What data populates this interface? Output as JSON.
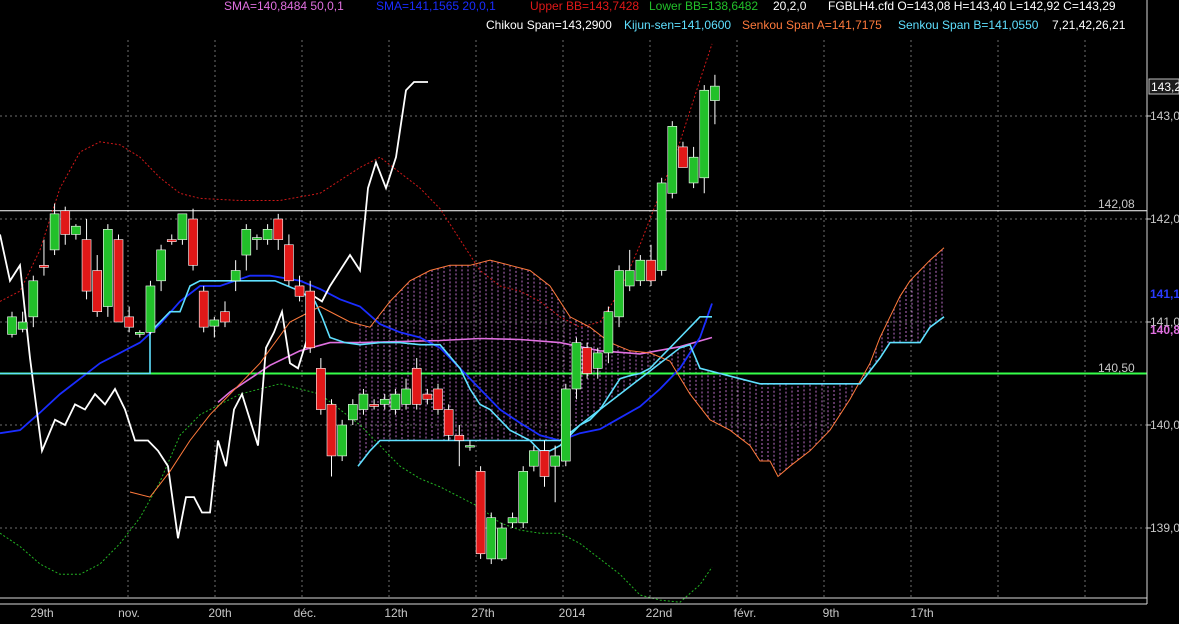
{
  "colors": {
    "background": "#000000",
    "grid": "#6e6e6e",
    "up_candle": "#22c02a",
    "down_candle": "#e01818",
    "sma50": "#e070e0",
    "sma20": "#1a2dff",
    "bollinger_upper": "#d01818",
    "bollinger_lower": "#22b322",
    "chikou": "#ffffff",
    "kijun": "#5fe0ff",
    "senkou_a": "#ff7a3c",
    "senkou_b": "#5fe0ff",
    "cloud_fill": "#d880e8",
    "level_white": "#ffffff",
    "level_green": "#36ff4a"
  },
  "legend": {
    "sma1": "SMA=140,8484  50,0,1",
    "sma2": "SMA=141,1565  20,0,1",
    "bb_upper": "Upper BB=143,7428",
    "bb_lower": "Lower BB=138,6482",
    "bb_params": "20,2,0",
    "instrument": "FGBLH4.cfd O=143,08 H=143,40 L=142,92 C=143,29",
    "chikou": "Chikou Span=143,2900",
    "kijun": "Kijun-sen=141,0600",
    "senkou_a": "Senkou Span A=141,7175",
    "senkou_b": "Senkou Span B=141,0550",
    "ichimoku_params": "7,21,42,26,21"
  },
  "price_tags": {
    "last": "143,2",
    "sma20": "141,1",
    "sma50": "140,8",
    "level_white": "142,08",
    "level_green": "140,50"
  },
  "chart_data": {
    "type": "candlestick",
    "instrument": "FGBLH4.cfd",
    "y_ticks": [
      "143,0",
      "142,0",
      "141,0",
      "140,0",
      "139,0"
    ],
    "y_tick_values": [
      143.0,
      142.0,
      141.0,
      140.0,
      139.0
    ],
    "x_labels": [
      "29th",
      "nov.",
      "20th",
      "déc.",
      "12th",
      "27th",
      "2014",
      "22nd",
      "févr.",
      "9th",
      "17th"
    ],
    "ylim": [
      138.35,
      143.55
    ],
    "grid": true,
    "horizontal_levels": [
      {
        "name": "level-white",
        "value": 142.08,
        "label": "142,08"
      },
      {
        "name": "level-green",
        "value": 140.5,
        "label": "140,50"
      }
    ],
    "candles": [
      {
        "o": 140.88,
        "h": 141.1,
        "l": 140.85,
        "c": 141.05
      },
      {
        "o": 140.93,
        "h": 141.1,
        "l": 140.9,
        "c": 141.0
      },
      {
        "o": 141.05,
        "h": 141.45,
        "l": 140.95,
        "c": 141.4
      },
      {
        "o": 141.55,
        "h": 141.8,
        "l": 141.45,
        "c": 141.53
      },
      {
        "o": 141.7,
        "h": 142.15,
        "l": 141.65,
        "c": 142.05
      },
      {
        "o": 142.08,
        "h": 142.12,
        "l": 141.75,
        "c": 141.85
      },
      {
        "o": 141.85,
        "h": 141.95,
        "l": 141.8,
        "c": 141.93
      },
      {
        "o": 141.8,
        "h": 142.0,
        "l": 141.22,
        "c": 141.3
      },
      {
        "o": 141.5,
        "h": 141.65,
        "l": 141.05,
        "c": 141.1
      },
      {
        "o": 141.15,
        "h": 141.95,
        "l": 141.05,
        "c": 141.9
      },
      {
        "o": 141.8,
        "h": 141.85,
        "l": 141.0,
        "c": 141.0
      },
      {
        "o": 141.05,
        "h": 141.15,
        "l": 140.9,
        "c": 140.95
      },
      {
        "o": 140.88,
        "h": 140.92,
        "l": 140.85,
        "c": 140.9
      },
      {
        "o": 140.9,
        "h": 141.4,
        "l": 140.88,
        "c": 141.35
      },
      {
        "o": 141.4,
        "h": 141.75,
        "l": 141.3,
        "c": 141.7
      },
      {
        "o": 141.8,
        "h": 141.85,
        "l": 141.75,
        "c": 141.78
      },
      {
        "o": 141.8,
        "h": 142.05,
        "l": 141.75,
        "c": 142.05
      },
      {
        "o": 142.0,
        "h": 142.1,
        "l": 141.5,
        "c": 141.55
      },
      {
        "o": 141.3,
        "h": 141.35,
        "l": 140.9,
        "c": 140.95
      },
      {
        "o": 140.96,
        "h": 141.05,
        "l": 140.85,
        "c": 141.02
      },
      {
        "o": 141.1,
        "h": 141.2,
        "l": 140.95,
        "c": 141.0
      },
      {
        "o": 141.4,
        "h": 141.6,
        "l": 141.3,
        "c": 141.5
      },
      {
        "o": 141.65,
        "h": 141.95,
        "l": 141.5,
        "c": 141.9
      },
      {
        "o": 141.8,
        "h": 141.85,
        "l": 141.7,
        "c": 141.82
      },
      {
        "o": 141.8,
        "h": 141.95,
        "l": 141.75,
        "c": 141.9
      },
      {
        "o": 142.0,
        "h": 142.05,
        "l": 141.7,
        "c": 141.8
      },
      {
        "o": 141.75,
        "h": 141.85,
        "l": 141.35,
        "c": 141.4
      },
      {
        "o": 141.35,
        "h": 141.45,
        "l": 141.2,
        "c": 141.25
      },
      {
        "o": 141.3,
        "h": 141.4,
        "l": 140.7,
        "c": 140.75
      },
      {
        "o": 140.55,
        "h": 140.65,
        "l": 140.1,
        "c": 140.15
      },
      {
        "o": 140.2,
        "h": 140.25,
        "l": 139.5,
        "c": 139.7
      },
      {
        "o": 139.7,
        "h": 140.05,
        "l": 139.65,
        "c": 140.0
      },
      {
        "o": 140.05,
        "h": 140.25,
        "l": 140.0,
        "c": 140.2
      },
      {
        "o": 140.15,
        "h": 140.35,
        "l": 140.1,
        "c": 140.3
      },
      {
        "o": 140.2,
        "h": 140.25,
        "l": 140.15,
        "c": 140.18
      },
      {
        "o": 140.2,
        "h": 140.3,
        "l": 140.15,
        "c": 140.25
      },
      {
        "o": 140.15,
        "h": 140.35,
        "l": 140.1,
        "c": 140.3
      },
      {
        "o": 140.2,
        "h": 140.45,
        "l": 140.15,
        "c": 140.35
      },
      {
        "o": 140.55,
        "h": 140.65,
        "l": 140.15,
        "c": 140.2
      },
      {
        "o": 140.3,
        "h": 140.35,
        "l": 140.2,
        "c": 140.25
      },
      {
        "o": 140.35,
        "h": 140.4,
        "l": 140.1,
        "c": 140.15
      },
      {
        "o": 140.15,
        "h": 140.2,
        "l": 139.85,
        "c": 139.9
      },
      {
        "o": 139.9,
        "h": 140.0,
        "l": 139.6,
        "c": 139.85
      },
      {
        "o": 139.8,
        "h": 139.85,
        "l": 139.75,
        "c": 139.8
      },
      {
        "o": 139.55,
        "h": 139.6,
        "l": 138.7,
        "c": 138.75
      },
      {
        "o": 138.7,
        "h": 139.15,
        "l": 138.65,
        "c": 139.1
      },
      {
        "o": 138.7,
        "h": 139.05,
        "l": 138.68,
        "c": 139.0
      },
      {
        "o": 139.05,
        "h": 139.15,
        "l": 139.0,
        "c": 139.1
      },
      {
        "o": 139.05,
        "h": 139.6,
        "l": 139.0,
        "c": 139.55
      },
      {
        "o": 139.6,
        "h": 139.8,
        "l": 139.55,
        "c": 139.75
      },
      {
        "o": 139.75,
        "h": 139.85,
        "l": 139.4,
        "c": 139.5
      },
      {
        "o": 139.6,
        "h": 139.8,
        "l": 139.25,
        "c": 139.7
      },
      {
        "o": 139.65,
        "h": 140.4,
        "l": 139.6,
        "c": 140.35
      },
      {
        "o": 140.35,
        "h": 140.85,
        "l": 140.25,
        "c": 140.8
      },
      {
        "o": 140.75,
        "h": 140.8,
        "l": 140.45,
        "c": 140.5
      },
      {
        "o": 140.55,
        "h": 140.75,
        "l": 140.45,
        "c": 140.7
      },
      {
        "o": 140.7,
        "h": 141.15,
        "l": 140.6,
        "c": 141.1
      },
      {
        "o": 141.05,
        "h": 141.55,
        "l": 140.95,
        "c": 141.5
      },
      {
        "o": 141.35,
        "h": 141.7,
        "l": 141.3,
        "c": 141.5
      },
      {
        "o": 141.4,
        "h": 141.65,
        "l": 141.35,
        "c": 141.6
      },
      {
        "o": 141.6,
        "h": 141.75,
        "l": 141.35,
        "c": 141.4
      },
      {
        "o": 141.5,
        "h": 142.4,
        "l": 141.45,
        "c": 142.35
      },
      {
        "o": 142.25,
        "h": 142.95,
        "l": 142.2,
        "c": 142.9
      },
      {
        "o": 142.7,
        "h": 142.75,
        "l": 142.5,
        "c": 142.5
      },
      {
        "o": 142.35,
        "h": 142.7,
        "l": 142.3,
        "c": 142.6
      },
      {
        "o": 142.4,
        "h": 143.3,
        "l": 142.25,
        "c": 143.25
      },
      {
        "o": 143.15,
        "h": 143.4,
        "l": 142.92,
        "c": 143.29
      }
    ],
    "series": [
      {
        "name": "SMA 50",
        "color": "#e070e0",
        "x": [
          218,
          230,
          250,
          270,
          300,
          330,
          360,
          400,
          440,
          480,
          520,
          560,
          600,
          640,
          680,
          712
        ],
        "y": [
          140.22,
          140.32,
          140.45,
          140.58,
          140.72,
          140.8,
          140.8,
          140.81,
          140.82,
          140.84,
          140.83,
          140.8,
          140.72,
          140.69,
          140.76,
          140.85
        ]
      },
      {
        "name": "SMA 20",
        "color": "#1a2dff",
        "x": [
          0,
          20,
          40,
          60,
          80,
          100,
          120,
          140,
          160,
          180,
          200,
          220,
          250,
          270,
          300,
          320,
          340,
          360,
          380,
          400,
          420,
          440,
          460,
          480,
          500,
          520,
          540,
          560,
          580,
          600,
          620,
          640,
          660,
          680,
          700,
          712
        ],
        "y": [
          139.92,
          139.95,
          140.12,
          140.3,
          140.45,
          140.6,
          140.7,
          140.8,
          140.98,
          141.2,
          141.35,
          141.35,
          141.45,
          141.45,
          141.4,
          141.32,
          141.22,
          141.15,
          140.98,
          140.9,
          140.85,
          140.75,
          140.55,
          140.35,
          140.15,
          140.02,
          139.9,
          139.85,
          139.92,
          139.96,
          140.07,
          140.18,
          140.35,
          140.55,
          140.85,
          141.18
        ]
      },
      {
        "name": "Upper BB",
        "color": "#d01818",
        "x": [
          0,
          20,
          40,
          60,
          80,
          100,
          120,
          140,
          160,
          180,
          200,
          240,
          280,
          320,
          360,
          380,
          400,
          420,
          440,
          460,
          480,
          500,
          520,
          540,
          560,
          580,
          600,
          620,
          640,
          660,
          680,
          700,
          712
        ],
        "y": [
          141.2,
          141.3,
          141.7,
          142.3,
          142.65,
          142.75,
          142.72,
          142.6,
          142.4,
          142.25,
          142.2,
          142.18,
          142.18,
          142.25,
          142.5,
          142.6,
          142.45,
          142.3,
          142.1,
          141.8,
          141.5,
          141.35,
          141.3,
          141.2,
          141.05,
          140.95,
          141.0,
          141.3,
          141.75,
          142.25,
          142.75,
          143.35,
          143.7
        ]
      },
      {
        "name": "Lower BB",
        "color": "#22b322",
        "x": [
          0,
          20,
          40,
          60,
          80,
          100,
          120,
          140,
          160,
          180,
          200,
          240,
          280,
          320,
          360,
          380,
          400,
          420,
          440,
          460,
          480,
          500,
          520,
          540,
          560,
          580,
          600,
          620,
          640,
          660,
          680,
          700,
          712
        ],
        "y": [
          138.95,
          138.82,
          138.65,
          138.55,
          138.55,
          138.65,
          138.85,
          139.1,
          139.45,
          139.9,
          140.1,
          140.3,
          140.4,
          140.3,
          140.0,
          139.8,
          139.6,
          139.48,
          139.4,
          139.3,
          139.2,
          139.05,
          138.98,
          138.95,
          138.95,
          138.85,
          138.7,
          138.55,
          138.35,
          138.3,
          138.28,
          138.45,
          138.62
        ]
      },
      {
        "name": "Chikou Span",
        "color": "#ffffff",
        "x": [
          0,
          10,
          20,
          30,
          42,
          55,
          65,
          75,
          85,
          95,
          105,
          115,
          125,
          135,
          148,
          158,
          168,
          178,
          186,
          194,
          202,
          210,
          218,
          226,
          234,
          242,
          250,
          258,
          266,
          274,
          282,
          290,
          298,
          306,
          314,
          322,
          330,
          340,
          350,
          360,
          368,
          376,
          386,
          396,
          406,
          414,
          428
        ],
        "y": [
          141.85,
          141.4,
          141.55,
          140.65,
          139.75,
          140.05,
          140.0,
          140.2,
          140.15,
          140.3,
          140.2,
          140.35,
          140.15,
          139.85,
          139.85,
          139.75,
          139.6,
          138.9,
          139.3,
          139.3,
          139.15,
          139.15,
          139.85,
          139.6,
          140.15,
          140.3,
          140.05,
          139.8,
          140.75,
          140.9,
          141.1,
          140.6,
          140.55,
          140.8,
          141.25,
          141.2,
          141.35,
          141.5,
          141.65,
          141.5,
          142.3,
          142.55,
          142.3,
          142.6,
          143.25,
          143.33,
          143.33
        ]
      },
      {
        "name": "Kijun-sen",
        "color": "#5fe0ff",
        "x": [
          0,
          150,
          150,
          160,
          170,
          180,
          190,
          200,
          275,
          300,
          315,
          322,
          330,
          345,
          360,
          380,
          400,
          420,
          440,
          460,
          470,
          480,
          490,
          500,
          510,
          520,
          530,
          540,
          550,
          560,
          570,
          580,
          590,
          600,
          610,
          620,
          630,
          640,
          650,
          660,
          670,
          680,
          690,
          700,
          712
        ],
        "y": [
          140.5,
          140.5,
          140.9,
          141.0,
          141.1,
          141.1,
          141.35,
          141.4,
          141.4,
          141.3,
          141.2,
          141.05,
          140.85,
          140.8,
          140.78,
          140.8,
          140.8,
          140.78,
          140.78,
          140.55,
          140.35,
          140.2,
          140.15,
          140.05,
          139.95,
          139.9,
          139.85,
          139.75,
          139.75,
          139.8,
          139.9,
          140.0,
          140.05,
          140.15,
          140.3,
          140.45,
          140.48,
          140.5,
          140.55,
          140.65,
          140.75,
          140.85,
          140.95,
          141.05,
          141.05
        ]
      },
      {
        "name": "Senkou Span A",
        "color": "#ff7a3c",
        "x": [
          130,
          150,
          170,
          190,
          210,
          230,
          260,
          290,
          320,
          350,
          370,
          390,
          410,
          430,
          450,
          470,
          490,
          510,
          530,
          550,
          570,
          590,
          610,
          630,
          650,
          670,
          690,
          710,
          730,
          750,
          760,
          770,
          778,
          790,
          810,
          830,
          850,
          870,
          880,
          890,
          900,
          910,
          920,
          930,
          944
        ],
        "y": [
          139.35,
          139.3,
          139.55,
          139.85,
          140.1,
          140.3,
          140.6,
          141.0,
          141.15,
          141.0,
          140.95,
          141.2,
          141.4,
          141.5,
          141.55,
          141.55,
          141.6,
          141.55,
          141.5,
          141.35,
          141.05,
          140.95,
          140.8,
          140.72,
          140.7,
          140.62,
          140.3,
          140.05,
          139.95,
          139.8,
          139.65,
          139.65,
          139.5,
          139.6,
          139.75,
          139.95,
          140.25,
          140.6,
          140.85,
          141.05,
          141.25,
          141.4,
          141.5,
          141.6,
          141.72
        ]
      },
      {
        "name": "Senkou Span B",
        "color": "#5fe0ff",
        "x": [
          358,
          370,
          380,
          400,
          420,
          460,
          500,
          560,
          600,
          620,
          640,
          660,
          680,
          690,
          700,
          720,
          740,
          760,
          800,
          860,
          880,
          890,
          900,
          920,
          930,
          944
        ],
        "y": [
          139.6,
          139.75,
          139.85,
          139.85,
          139.85,
          139.85,
          139.85,
          139.85,
          140.15,
          140.3,
          140.45,
          140.6,
          140.75,
          140.78,
          140.55,
          140.5,
          140.45,
          140.4,
          140.4,
          140.4,
          140.65,
          140.8,
          140.8,
          140.8,
          140.95,
          141.05
        ]
      }
    ],
    "cloud_x_range": [
      360,
      944
    ]
  }
}
